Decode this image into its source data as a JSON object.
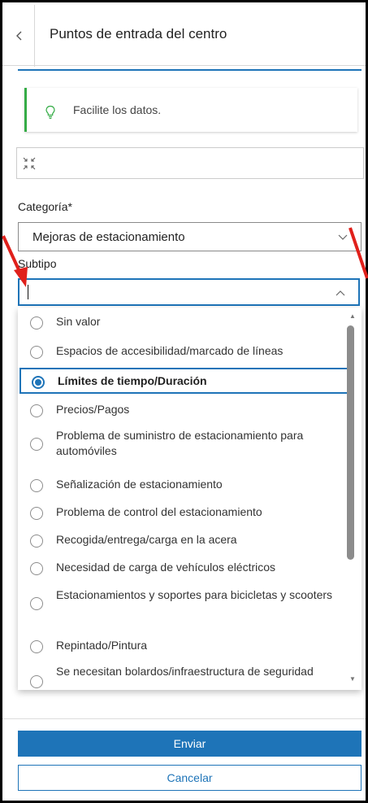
{
  "header": {
    "title": "Puntos de entrada del centro",
    "back_icon": "chevron-left-icon"
  },
  "notice": {
    "text": "Facilite los datos.",
    "icon": "lightbulb-icon",
    "accent": "#35ac46"
  },
  "toolbar": {
    "collapse_icon": "collapse-icon"
  },
  "fields": {
    "category": {
      "label": "Categoría*",
      "value": "Mejoras de estacionamiento"
    },
    "subtype": {
      "label": "Subtipo",
      "value": ""
    }
  },
  "subtype_options": [
    {
      "label": "Sin valor"
    },
    {
      "label": "Espacios de accesibilidad/marcado de líneas"
    },
    {
      "label": "Límites de tiempo/Duración"
    },
    {
      "label": "Precios/Pagos"
    },
    {
      "label": "Problema de suministro de estacionamiento para automóviles"
    },
    {
      "label": "Señalización de estacionamiento"
    },
    {
      "label": "Problema de control del estacionamiento"
    },
    {
      "label": "Recogida/entrega/carga en la acera"
    },
    {
      "label": "Necesidad de carga de vehículos eléctricos"
    },
    {
      "label": "Estacionamientos y soportes para bicicletas y scooters"
    },
    {
      "label": "Repintado/Pintura"
    },
    {
      "label": "Se necesitan bolardos/infraestructura de seguridad"
    }
  ],
  "selected_option": "Límites de tiempo/Duración",
  "buttons": {
    "submit": "Enviar",
    "cancel": "Cancelar"
  },
  "colors": {
    "primary": "#1e74b8",
    "annotation_arrow": "#e0201b"
  }
}
